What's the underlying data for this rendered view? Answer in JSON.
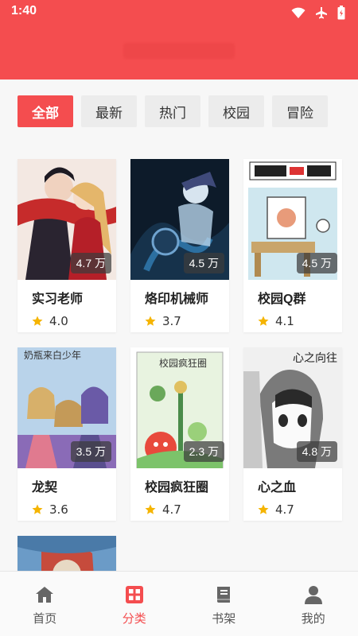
{
  "status_bar": {
    "time": "1:40",
    "icons": [
      "wifi-icon",
      "airplane-icon",
      "battery-icon"
    ]
  },
  "header": {
    "title": ""
  },
  "filters": [
    {
      "label": "全部",
      "active": true
    },
    {
      "label": "最新",
      "active": false
    },
    {
      "label": "热门",
      "active": false
    },
    {
      "label": "校园",
      "active": false
    },
    {
      "label": "冒险",
      "active": false
    }
  ],
  "comics": [
    {
      "title": "实习老师",
      "views": "4.7 万",
      "rating": "4.0",
      "cover_colors": [
        "#f3e8e2",
        "#c62b2b",
        "#2a2430"
      ]
    },
    {
      "title": "烙印机械师",
      "views": "4.5 万",
      "rating": "3.7",
      "cover_colors": [
        "#0d1b2a",
        "#2c6fa0",
        "#b7d3ea"
      ]
    },
    {
      "title": "校园Q群",
      "views": "4.5 万",
      "rating": "4.1",
      "cover_colors": [
        "#cfe7ef",
        "#c9a56b",
        "#ffffff"
      ]
    },
    {
      "title": "龙契",
      "views": "3.5 万",
      "rating": "3.6",
      "cover_colors": [
        "#b9d3ea",
        "#8a6bb7",
        "#f2c98f"
      ],
      "cover_text": "奶瓶来白少年"
    },
    {
      "title": "校园疯狂圈",
      "views": "2.3 万",
      "rating": "4.7",
      "cover_colors": [
        "#e8f3e0",
        "#7cc36a",
        "#e84a3c"
      ],
      "cover_text": "校园疯狂圈"
    },
    {
      "title": "心之血",
      "views": "4.8 万",
      "rating": "4.7",
      "cover_colors": [
        "#f0f0f0",
        "#7a7a7a",
        "#2a2a2a"
      ],
      "cover_text": "心之向往"
    },
    {
      "title": "",
      "views": "",
      "rating": "",
      "cover_colors": [
        "#6b9bc7",
        "#c64b3c",
        "#e7d9c4"
      ]
    }
  ],
  "bottom_nav": [
    {
      "label": "首页",
      "icon": "home-icon",
      "active": false
    },
    {
      "label": "分类",
      "icon": "category-icon",
      "active": true
    },
    {
      "label": "书架",
      "icon": "bookshelf-icon",
      "active": false
    },
    {
      "label": "我的",
      "icon": "profile-icon",
      "active": false
    }
  ],
  "colors": {
    "accent": "#f44d4f",
    "star": "#f5b400"
  }
}
